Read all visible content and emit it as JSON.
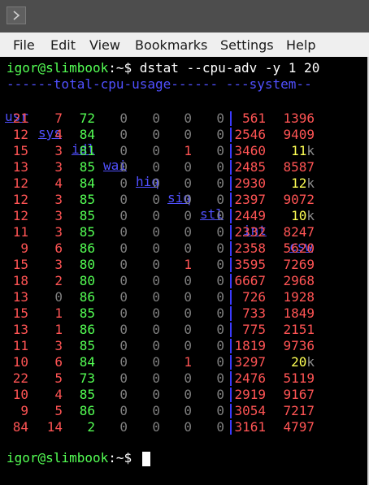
{
  "window": {
    "icon": "terminal-icon"
  },
  "menu": [
    "File",
    "Edit",
    "View",
    "Bookmarks",
    "Settings",
    "Help"
  ],
  "prompt": {
    "user_host": "igor@slimbook",
    "path": ":~",
    "symbol": "$ ",
    "command": "dstat --cpu-adv -y 1 20"
  },
  "header_groups": {
    "cpu": "------total-cpu-usage------",
    "system": "---system--"
  },
  "columns": [
    "usr",
    "sys",
    "idl",
    "wai",
    "hiq",
    "siq",
    "stl",
    "int",
    "csw"
  ],
  "rows": [
    [
      "21",
      "7",
      "72",
      "0",
      "0",
      "0",
      "0",
      "561",
      "1396"
    ],
    [
      "12",
      "4",
      "84",
      "0",
      "0",
      "0",
      "0",
      "2546",
      "9409"
    ],
    [
      "15",
      "3",
      "81",
      "0",
      "0",
      "1",
      "0",
      "3460",
      "11k"
    ],
    [
      "13",
      "3",
      "85",
      "0",
      "0",
      "0",
      "0",
      "2485",
      "8587"
    ],
    [
      "12",
      "4",
      "84",
      "0",
      "0",
      "0",
      "0",
      "2930",
      "12k"
    ],
    [
      "12",
      "3",
      "85",
      "0",
      "0",
      "0",
      "0",
      "2397",
      "9072"
    ],
    [
      "12",
      "3",
      "85",
      "0",
      "0",
      "0",
      "0",
      "2449",
      "10k"
    ],
    [
      "11",
      "3",
      "85",
      "0",
      "0",
      "0",
      "0",
      "2332",
      "8247"
    ],
    [
      "9",
      "6",
      "86",
      "0",
      "0",
      "0",
      "0",
      "2358",
      "5620"
    ],
    [
      "15",
      "3",
      "80",
      "0",
      "0",
      "1",
      "0",
      "3595",
      "7269"
    ],
    [
      "18",
      "2",
      "80",
      "0",
      "0",
      "0",
      "0",
      "6667",
      "2968"
    ],
    [
      "13",
      "0",
      "86",
      "0",
      "0",
      "0",
      "0",
      "726",
      "1928"
    ],
    [
      "15",
      "1",
      "85",
      "0",
      "0",
      "0",
      "0",
      "733",
      "1849"
    ],
    [
      "13",
      "1",
      "86",
      "0",
      "0",
      "0",
      "0",
      "775",
      "2151"
    ],
    [
      "11",
      "3",
      "85",
      "0",
      "0",
      "0",
      "0",
      "1819",
      "9736"
    ],
    [
      "10",
      "6",
      "84",
      "0",
      "0",
      "1",
      "0",
      "3297",
      "20k"
    ],
    [
      "22",
      "5",
      "73",
      "0",
      "0",
      "0",
      "0",
      "2476",
      "5119"
    ],
    [
      "10",
      "4",
      "85",
      "0",
      "0",
      "0",
      "0",
      "2919",
      "9167"
    ],
    [
      "9",
      "5",
      "86",
      "0",
      "0",
      "0",
      "0",
      "3054",
      "7217"
    ],
    [
      "84",
      "14",
      "2",
      "0",
      "0",
      "0",
      "0",
      "3161",
      "4797"
    ]
  ],
  "colors": {
    "background": "#000000",
    "prompt": "#54ff54",
    "header": "#5050ff",
    "high": "#ff5454",
    "idle": "#54ff54",
    "zero": "#7f7f7f",
    "thousands": "#ffff54"
  }
}
